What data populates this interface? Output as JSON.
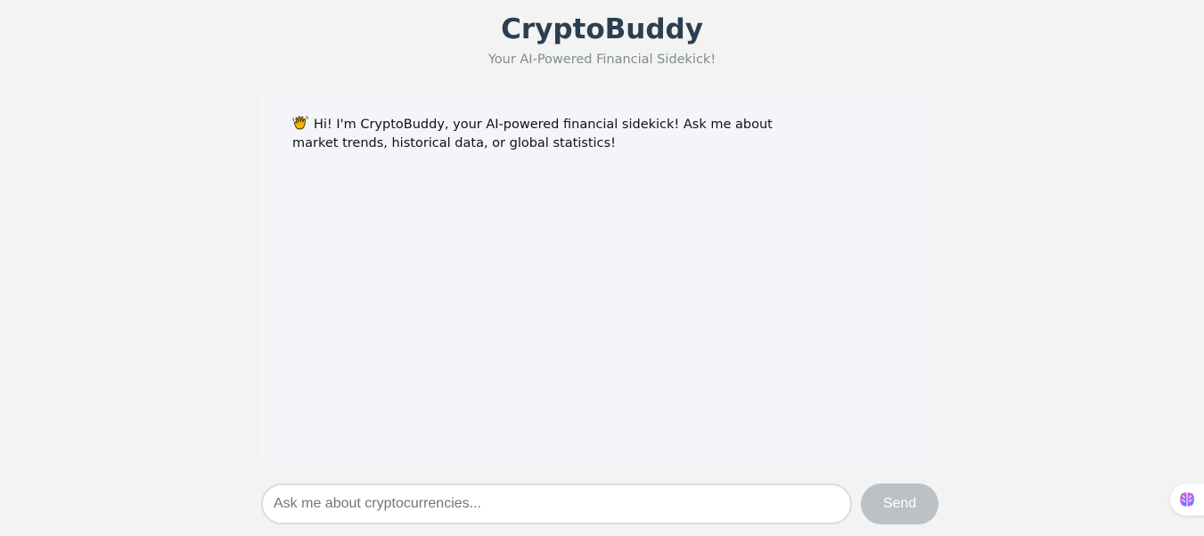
{
  "header": {
    "title": "CryptoBuddy",
    "subtitle": "Your AI-Powered Financial Sidekick!"
  },
  "chat": {
    "messages": [
      {
        "icon": "waving-hand-icon",
        "text": "Hi! I'm CryptoBuddy, your AI-powered financial sidekick! Ask me about market trends, historical data, or global statistics!"
      }
    ]
  },
  "composer": {
    "input_value": "",
    "input_placeholder": "Ask me about cryptocurrencies...",
    "send_label": "Send"
  },
  "widget": {
    "icon": "brain-icon"
  },
  "colors": {
    "background": "#f3f3f3",
    "title": "#2c3e50",
    "subtitle": "#7f8c8d",
    "chat_panel": "#f4f5f9",
    "send_button_disabled": "#bcc1c5"
  }
}
